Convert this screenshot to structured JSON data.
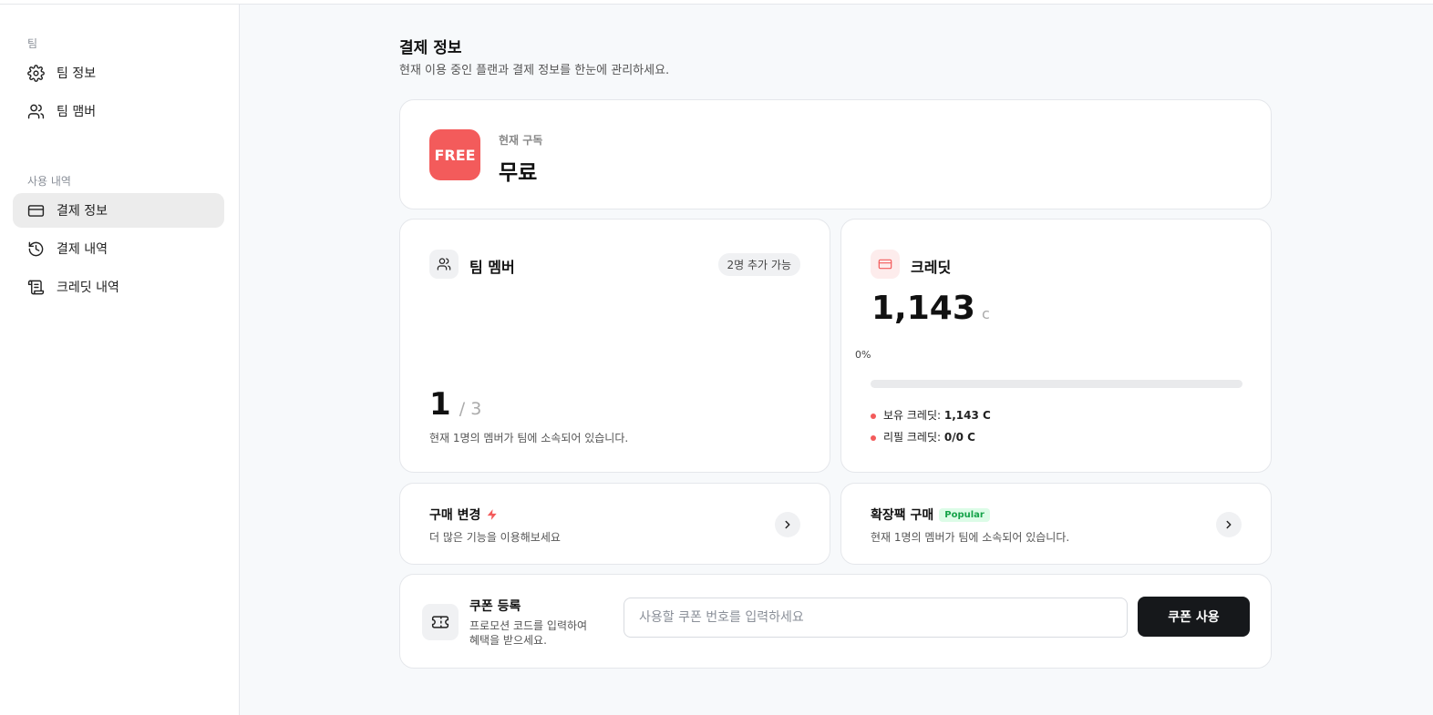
{
  "sidebar": {
    "team_section_label": "팀",
    "usage_section_label": "사용 내역",
    "items": [
      {
        "label": "팀 정보"
      },
      {
        "label": "팀 맴버"
      },
      {
        "label": "결제 정보"
      },
      {
        "label": "결제 내역"
      },
      {
        "label": "크레딧 내역"
      }
    ]
  },
  "page": {
    "title": "결제 정보",
    "subtitle": "현재 이용 중인 플랜과 결제 정보를 한눈에 관리하세요."
  },
  "subscription": {
    "badge": "FREE",
    "label": "현재 구독",
    "plan": "무료"
  },
  "members": {
    "title": "팀 멤버",
    "pill": "2명 추가 가능",
    "count": "1",
    "total": "/ 3",
    "description": "현재 1명의 멤버가 팀에 소속되어 있습니다."
  },
  "credits": {
    "title": "크레딧",
    "amount": "1,143",
    "unit": "c",
    "percent_label": "0%",
    "progress": 0,
    "owned_label": "보유 크레딧:",
    "owned_value": "1,143 C",
    "refill_label": "리필 크레딧:",
    "refill_value": "0/0 C"
  },
  "purchase_change": {
    "title": "구매 변경",
    "description": "더 많은 기능을 이용해보세요"
  },
  "expansion": {
    "title": "확장팩 구매",
    "badge": "Popular",
    "description": "현재 1명의 멤버가 팀에 소속되어 있습니다."
  },
  "coupon": {
    "title": "쿠폰 등록",
    "description_line1": "프로모션 코드를 입력하여",
    "description_line2": "혜택을 받으세요.",
    "placeholder": "사용할 쿠폰 번호를 입력하세요",
    "button_label": "쿠폰 사용"
  },
  "colors": {
    "accent_red": "#f35b5b",
    "popular_bg": "#dcfce7",
    "popular_text": "#16a34a",
    "dark_button": "#16181b"
  }
}
